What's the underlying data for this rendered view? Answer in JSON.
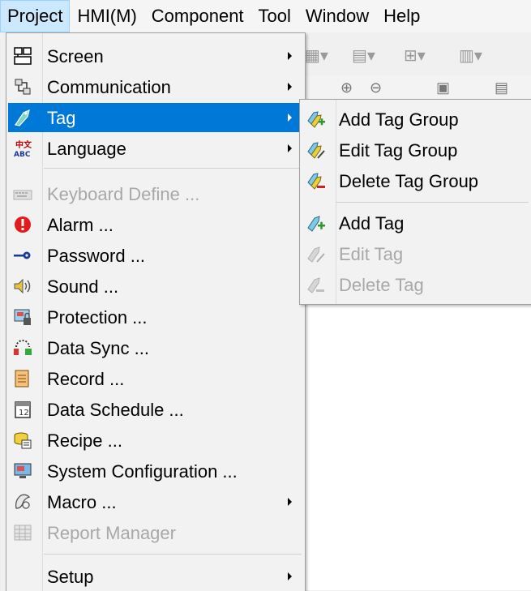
{
  "menubar": {
    "items": [
      {
        "label": "Project"
      },
      {
        "label": "HMI(M)"
      },
      {
        "label": "Component"
      },
      {
        "label": "Tool"
      },
      {
        "label": "Window"
      },
      {
        "label": "Help"
      }
    ]
  },
  "project_menu": {
    "items": [
      {
        "label": "Screen",
        "icon": "screen-icon",
        "submenu": true
      },
      {
        "label": "Communication",
        "icon": "communication-icon",
        "submenu": true
      },
      {
        "label": "Tag",
        "icon": "tag-icon",
        "submenu": true,
        "highlighted": true
      },
      {
        "label": "Language",
        "icon": "language-icon",
        "submenu": true
      },
      {
        "label": "Keyboard Define ...",
        "icon": "keyboard-icon",
        "disabled": true
      },
      {
        "label": "Alarm ...",
        "icon": "alarm-icon"
      },
      {
        "label": "Password ...",
        "icon": "password-key-icon"
      },
      {
        "label": "Sound ...",
        "icon": "sound-icon"
      },
      {
        "label": "Protection ...",
        "icon": "protection-icon"
      },
      {
        "label": "Data Sync ...",
        "icon": "data-sync-icon"
      },
      {
        "label": "Record ...",
        "icon": "record-icon"
      },
      {
        "label": "Data Schedule ...",
        "icon": "data-schedule-icon"
      },
      {
        "label": "Recipe ...",
        "icon": "recipe-icon"
      },
      {
        "label": "System Configuration ...",
        "icon": "system-configuration-icon"
      },
      {
        "label": "Macro ...",
        "icon": "macro-icon",
        "submenu": true
      },
      {
        "label": "Report Manager",
        "icon": "report-manager-icon",
        "disabled": true
      },
      {
        "label": "Setup",
        "submenu": true
      }
    ]
  },
  "tag_submenu": {
    "items": [
      {
        "label": "Add Tag Group",
        "icon": "add-tag-group-icon"
      },
      {
        "label": "Edit Tag Group",
        "icon": "edit-tag-group-icon"
      },
      {
        "label": "Delete Tag Group",
        "icon": "delete-tag-group-icon"
      },
      {
        "label": "Add Tag",
        "icon": "add-tag-icon"
      },
      {
        "label": "Edit Tag",
        "icon": "edit-tag-icon",
        "disabled": true
      },
      {
        "label": "Delete Tag",
        "icon": "delete-tag-icon",
        "disabled": true
      }
    ]
  },
  "colors": {
    "highlight": "#0078d7",
    "menu_bg": "#f2f2f2",
    "disabled_text": "#a8a8a8"
  }
}
